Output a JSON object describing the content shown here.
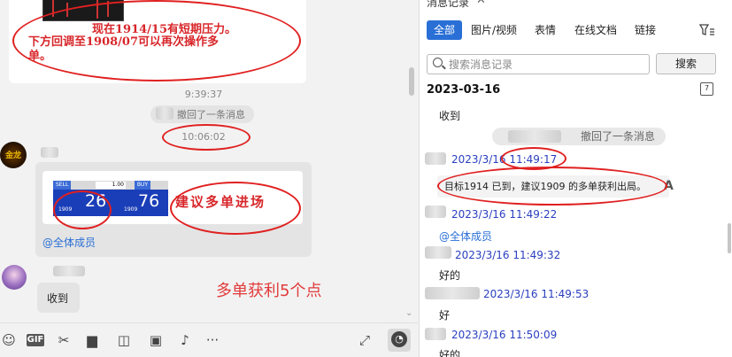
{
  "chat": {
    "handwritten_note_line1": "现在1914/15有短期压力。",
    "handwritten_note_line2": "下方回调至1908/07可以再次操作多",
    "handwritten_note_line3": "单。",
    "timestamp_1": "9:39:37",
    "recall_notice": "撤回了一条消息",
    "timestamp_2": "10:06:02",
    "ticker": {
      "sell_label": "SELL",
      "buy_label": "BUY",
      "quantity": "1.00",
      "sell_small": "1909",
      "sell_big": "26",
      "buy_small": "1909",
      "buy_big": "76"
    },
    "handwritten_annotation": "建议多单进场",
    "mention_all": "@全体成员",
    "reply_text": "收到",
    "big_annotation": "多单获利5个点"
  },
  "toolbar": {
    "emoji_icon": "emoji-icon",
    "gif_label": "GIF",
    "scissors_icon": "scissors-icon",
    "folder_icon": "folder-icon",
    "image_icon": "image-icon",
    "bell_icon": "bell-icon",
    "more_icon": "more-icon",
    "expand_icon": "expand-icon",
    "history_icon": "history-clock-icon"
  },
  "history": {
    "title": "消息记录",
    "tabs": [
      "全部",
      "图片/视频",
      "表情",
      "在线文档",
      "链接"
    ],
    "active_tab": 0,
    "search_placeholder": "搜索消息记录",
    "search_button": "搜索",
    "date": "2023-03-16",
    "calendar_label": "7",
    "first_msg": "收到",
    "recall_notice": "撤回了一条消息",
    "entries": [
      {
        "time": "2023/3/16 11:49:17",
        "text": "目标1914 已到，建议1909 的多单获利出局。"
      },
      {
        "time": "2023/3/16 11:49:22",
        "text": "@全体成员"
      },
      {
        "time": "2023/3/16 11:49:32",
        "text": "好的"
      },
      {
        "time": "2023/3/16 11:49:53",
        "text": "好"
      },
      {
        "time": "2023/3/16 11:50:09",
        "text": "好的"
      }
    ]
  },
  "colors": {
    "accent": "#2a6fd6",
    "annotation_red": "#e02020",
    "sender_blue": "#2a3fbf"
  }
}
